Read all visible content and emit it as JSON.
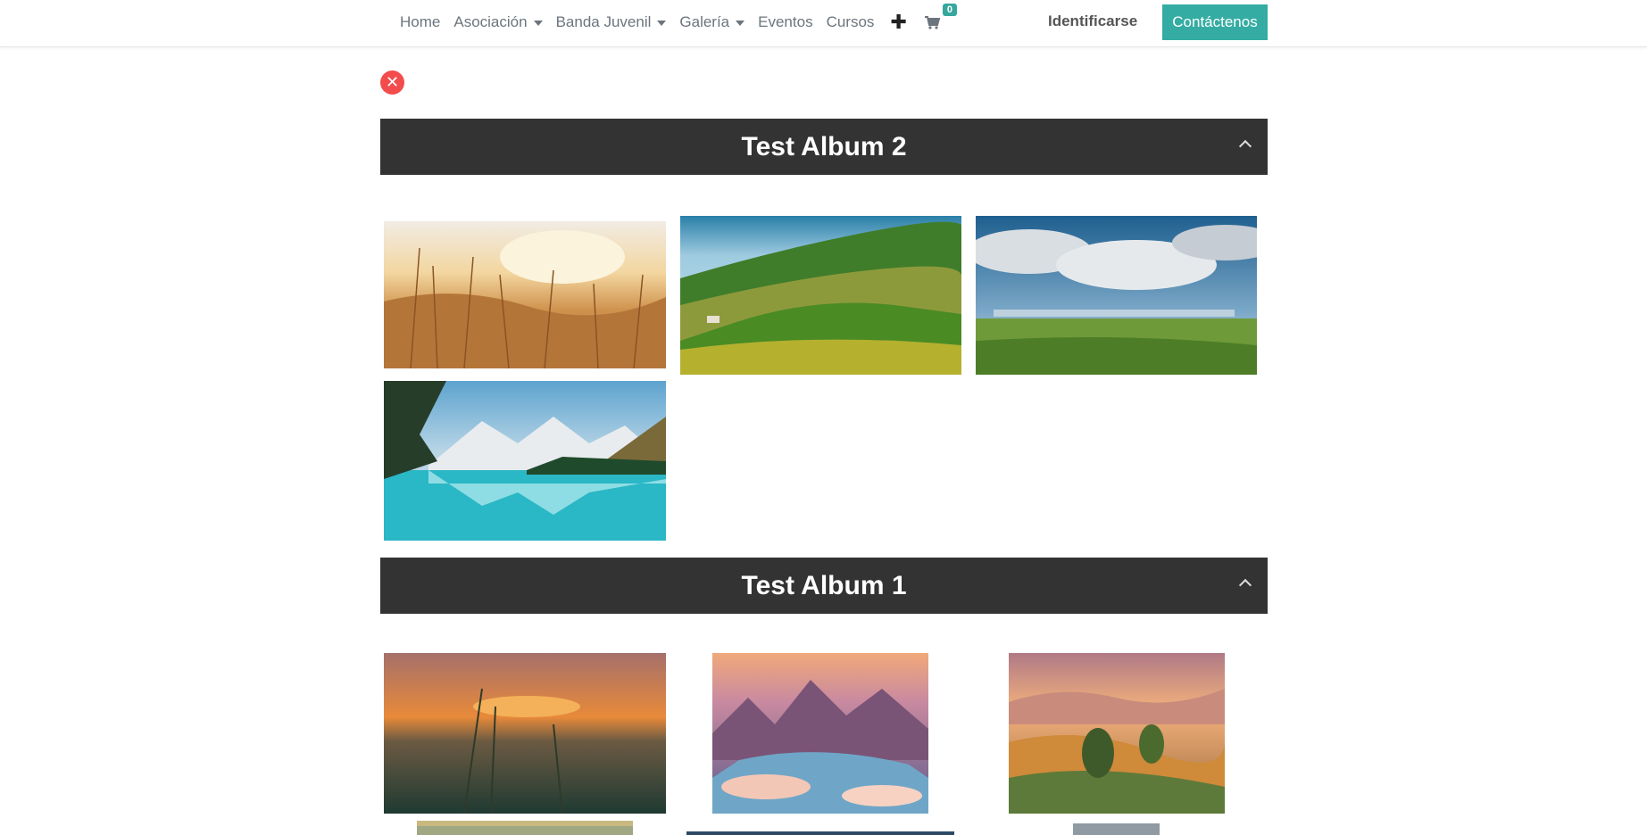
{
  "nav": {
    "items": [
      {
        "label": "Home",
        "dropdown": false
      },
      {
        "label": "Asociación",
        "dropdown": true
      },
      {
        "label": "Banda Juvenil",
        "dropdown": true
      },
      {
        "label": "Galería",
        "dropdown": true
      },
      {
        "label": "Eventos",
        "dropdown": false
      },
      {
        "label": "Cursos",
        "dropdown": false
      }
    ],
    "plus_icon": "plus-icon",
    "cart_icon": "shopping-cart-icon",
    "cart_count": "0",
    "signin_label": "Identificarse",
    "contact_label": "Contáctenos"
  },
  "close_icon": "close-icon",
  "albums": [
    {
      "title": "Test Album 2"
    },
    {
      "title": "Test Album 1"
    }
  ],
  "colors": {
    "accent": "#35aca3",
    "album_header_bg": "#333333",
    "close_button": "#f24c4c"
  }
}
